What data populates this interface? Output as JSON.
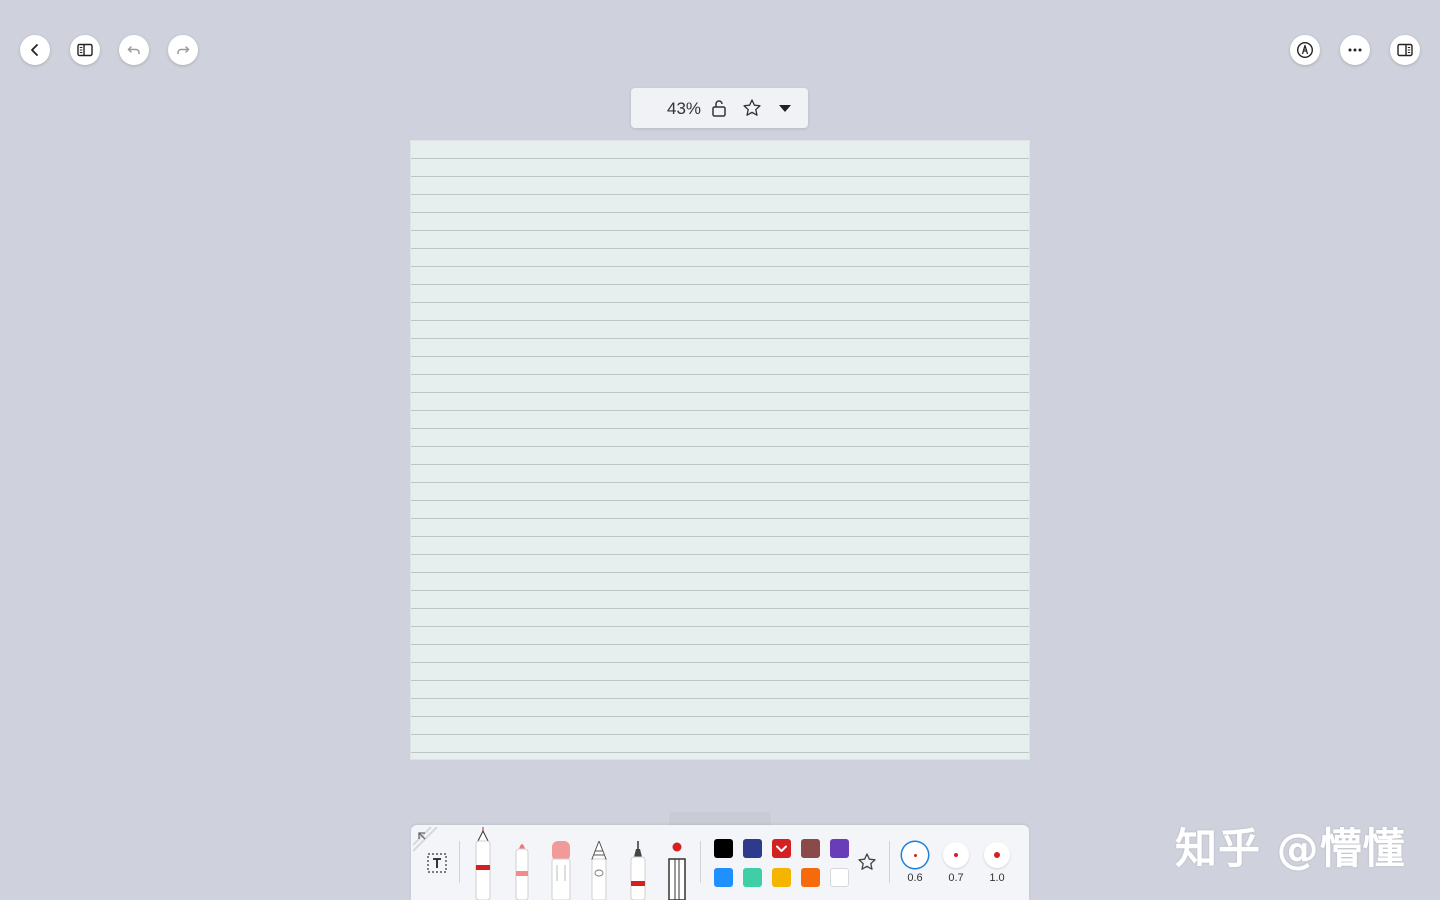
{
  "top_left": {
    "buttons": [
      {
        "name": "back-button",
        "icon": "chevron-left-icon"
      },
      {
        "name": "sidebar-toggle-button",
        "icon": "sidebar-icon"
      },
      {
        "name": "undo-button",
        "icon": "undo-icon"
      },
      {
        "name": "redo-button",
        "icon": "redo-icon"
      }
    ]
  },
  "top_right": {
    "buttons": [
      {
        "name": "pen-mode-button",
        "icon": "pen-nib-icon"
      },
      {
        "name": "more-options-button",
        "icon": "more-horizontal-icon"
      },
      {
        "name": "split-view-button",
        "icon": "split-view-icon"
      }
    ]
  },
  "zoom_bar": {
    "zoom_label": "43%",
    "icons": [
      "unlock-icon",
      "star-outline-icon",
      "caret-down-icon"
    ]
  },
  "page": {
    "paper": "lined",
    "background_color": "#e6eeee",
    "line_color": "#b9c7c9"
  },
  "toolbar": {
    "text_tool_icon": "text-box-icon",
    "tools": [
      "fountain-pen",
      "marker",
      "eraser",
      "pencil",
      "ballpoint-pen",
      "ruler"
    ],
    "colors": [
      {
        "hex": "#000000"
      },
      {
        "hex": "#2e3a8c"
      },
      {
        "hex": "#d32121",
        "selected": true
      },
      {
        "hex": "#8b4a4a"
      },
      {
        "hex": "#6a3db8"
      },
      {
        "hex": "#1e90ff"
      },
      {
        "hex": "#3ecfa7"
      },
      {
        "hex": "#f5b400"
      },
      {
        "hex": "#f76a0c"
      },
      {
        "hex": "#ffffff"
      }
    ],
    "favorite_icon": "star-outline-icon",
    "sizes": [
      {
        "label": "0.6",
        "selected": true
      },
      {
        "label": "0.7",
        "selected": false
      },
      {
        "label": "1.0",
        "selected": false
      }
    ]
  },
  "watermark": "知乎 @懵懂"
}
